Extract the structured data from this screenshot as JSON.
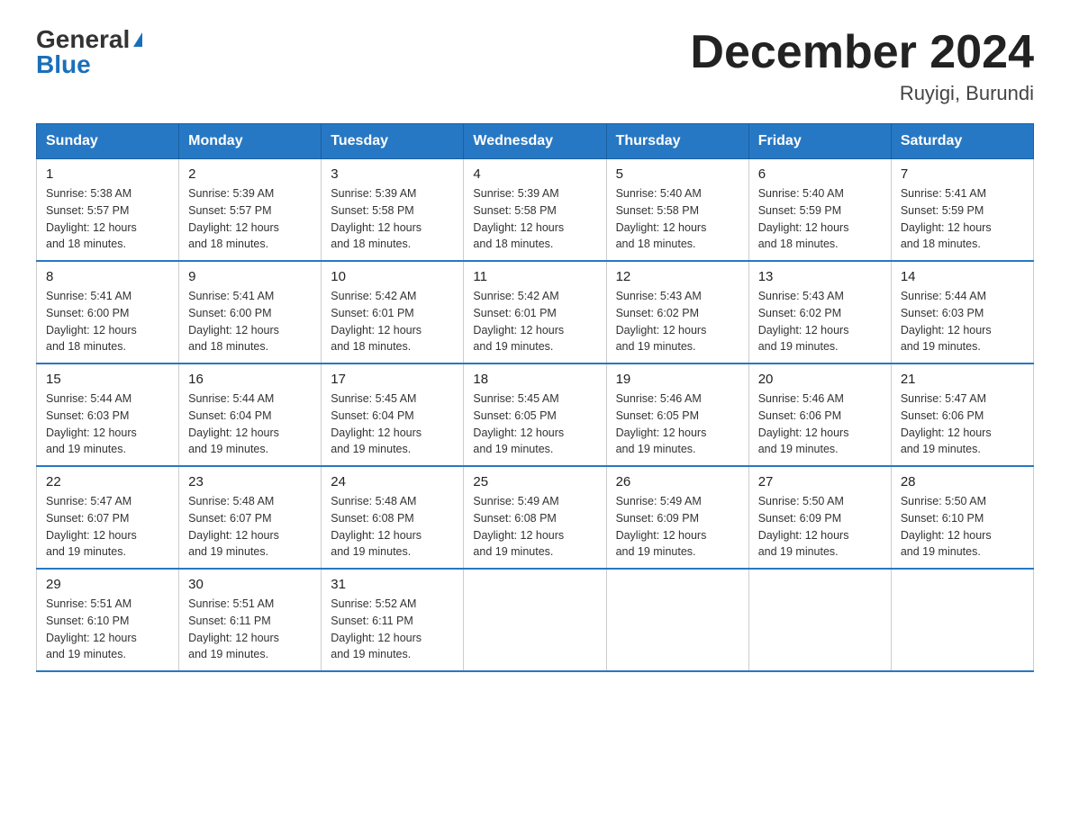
{
  "header": {
    "logo_general": "General",
    "logo_blue": "Blue",
    "month_title": "December 2024",
    "location": "Ruyigi, Burundi"
  },
  "days_of_week": [
    "Sunday",
    "Monday",
    "Tuesday",
    "Wednesday",
    "Thursday",
    "Friday",
    "Saturday"
  ],
  "weeks": [
    [
      {
        "day": "1",
        "sunrise": "5:38 AM",
        "sunset": "5:57 PM",
        "daylight": "12 hours and 18 minutes."
      },
      {
        "day": "2",
        "sunrise": "5:39 AM",
        "sunset": "5:57 PM",
        "daylight": "12 hours and 18 minutes."
      },
      {
        "day": "3",
        "sunrise": "5:39 AM",
        "sunset": "5:58 PM",
        "daylight": "12 hours and 18 minutes."
      },
      {
        "day": "4",
        "sunrise": "5:39 AM",
        "sunset": "5:58 PM",
        "daylight": "12 hours and 18 minutes."
      },
      {
        "day": "5",
        "sunrise": "5:40 AM",
        "sunset": "5:58 PM",
        "daylight": "12 hours and 18 minutes."
      },
      {
        "day": "6",
        "sunrise": "5:40 AM",
        "sunset": "5:59 PM",
        "daylight": "12 hours and 18 minutes."
      },
      {
        "day": "7",
        "sunrise": "5:41 AM",
        "sunset": "5:59 PM",
        "daylight": "12 hours and 18 minutes."
      }
    ],
    [
      {
        "day": "8",
        "sunrise": "5:41 AM",
        "sunset": "6:00 PM",
        "daylight": "12 hours and 18 minutes."
      },
      {
        "day": "9",
        "sunrise": "5:41 AM",
        "sunset": "6:00 PM",
        "daylight": "12 hours and 18 minutes."
      },
      {
        "day": "10",
        "sunrise": "5:42 AM",
        "sunset": "6:01 PM",
        "daylight": "12 hours and 18 minutes."
      },
      {
        "day": "11",
        "sunrise": "5:42 AM",
        "sunset": "6:01 PM",
        "daylight": "12 hours and 19 minutes."
      },
      {
        "day": "12",
        "sunrise": "5:43 AM",
        "sunset": "6:02 PM",
        "daylight": "12 hours and 19 minutes."
      },
      {
        "day": "13",
        "sunrise": "5:43 AM",
        "sunset": "6:02 PM",
        "daylight": "12 hours and 19 minutes."
      },
      {
        "day": "14",
        "sunrise": "5:44 AM",
        "sunset": "6:03 PM",
        "daylight": "12 hours and 19 minutes."
      }
    ],
    [
      {
        "day": "15",
        "sunrise": "5:44 AM",
        "sunset": "6:03 PM",
        "daylight": "12 hours and 19 minutes."
      },
      {
        "day": "16",
        "sunrise": "5:44 AM",
        "sunset": "6:04 PM",
        "daylight": "12 hours and 19 minutes."
      },
      {
        "day": "17",
        "sunrise": "5:45 AM",
        "sunset": "6:04 PM",
        "daylight": "12 hours and 19 minutes."
      },
      {
        "day": "18",
        "sunrise": "5:45 AM",
        "sunset": "6:05 PM",
        "daylight": "12 hours and 19 minutes."
      },
      {
        "day": "19",
        "sunrise": "5:46 AM",
        "sunset": "6:05 PM",
        "daylight": "12 hours and 19 minutes."
      },
      {
        "day": "20",
        "sunrise": "5:46 AM",
        "sunset": "6:06 PM",
        "daylight": "12 hours and 19 minutes."
      },
      {
        "day": "21",
        "sunrise": "5:47 AM",
        "sunset": "6:06 PM",
        "daylight": "12 hours and 19 minutes."
      }
    ],
    [
      {
        "day": "22",
        "sunrise": "5:47 AM",
        "sunset": "6:07 PM",
        "daylight": "12 hours and 19 minutes."
      },
      {
        "day": "23",
        "sunrise": "5:48 AM",
        "sunset": "6:07 PM",
        "daylight": "12 hours and 19 minutes."
      },
      {
        "day": "24",
        "sunrise": "5:48 AM",
        "sunset": "6:08 PM",
        "daylight": "12 hours and 19 minutes."
      },
      {
        "day": "25",
        "sunrise": "5:49 AM",
        "sunset": "6:08 PM",
        "daylight": "12 hours and 19 minutes."
      },
      {
        "day": "26",
        "sunrise": "5:49 AM",
        "sunset": "6:09 PM",
        "daylight": "12 hours and 19 minutes."
      },
      {
        "day": "27",
        "sunrise": "5:50 AM",
        "sunset": "6:09 PM",
        "daylight": "12 hours and 19 minutes."
      },
      {
        "day": "28",
        "sunrise": "5:50 AM",
        "sunset": "6:10 PM",
        "daylight": "12 hours and 19 minutes."
      }
    ],
    [
      {
        "day": "29",
        "sunrise": "5:51 AM",
        "sunset": "6:10 PM",
        "daylight": "12 hours and 19 minutes."
      },
      {
        "day": "30",
        "sunrise": "5:51 AM",
        "sunset": "6:11 PM",
        "daylight": "12 hours and 19 minutes."
      },
      {
        "day": "31",
        "sunrise": "5:52 AM",
        "sunset": "6:11 PM",
        "daylight": "12 hours and 19 minutes."
      },
      null,
      null,
      null,
      null
    ]
  ],
  "labels": {
    "sunrise": "Sunrise:",
    "sunset": "Sunset:",
    "daylight": "Daylight:"
  }
}
